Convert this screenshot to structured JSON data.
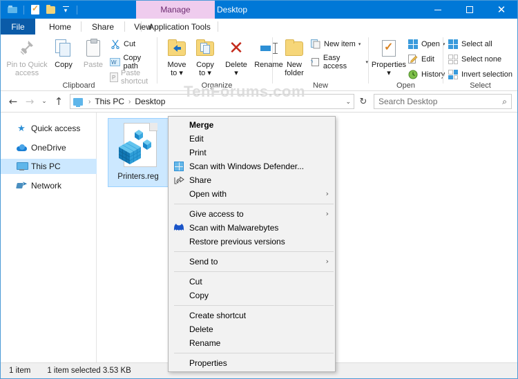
{
  "window": {
    "title": "Desktop",
    "contextual_tab": "Manage",
    "watermark": "TenForums.com",
    "controls": {
      "minimize": "–",
      "maximize": "□",
      "close": "✕"
    }
  },
  "quick_access_toolbar": {
    "items": [
      {
        "name": "explorer-icon",
        "label": "File Explorer"
      },
      {
        "name": "properties-icon",
        "label": "Properties"
      },
      {
        "name": "new-folder-icon",
        "label": "New folder"
      },
      {
        "name": "customize-icon",
        "label": "Customize Quick Access Toolbar"
      }
    ]
  },
  "tabs": [
    {
      "id": "file",
      "label": "File"
    },
    {
      "id": "home",
      "label": "Home"
    },
    {
      "id": "share",
      "label": "Share"
    },
    {
      "id": "view",
      "label": "View"
    },
    {
      "id": "application-tools",
      "label": "Application Tools"
    }
  ],
  "selected_tab": "Home",
  "ribbon": {
    "collapse_label": "^",
    "help_label": "?",
    "groups": [
      {
        "id": "clipboard",
        "label": "Clipboard",
        "big_buttons": [
          {
            "id": "pin-to-quick-access",
            "label": "Pin to Quick\naccess",
            "line1": "Pin to Quick",
            "line2": "access",
            "enabled": false
          },
          {
            "id": "copy",
            "label": "Copy",
            "enabled": true
          },
          {
            "id": "paste",
            "label": "Paste",
            "enabled": false
          }
        ],
        "small_buttons": [
          {
            "id": "cut",
            "label": "Cut",
            "enabled": true
          },
          {
            "id": "copy-path",
            "label": "Copy path",
            "enabled": true
          },
          {
            "id": "paste-shortcut",
            "label": "Paste shortcut",
            "enabled": false
          }
        ]
      },
      {
        "id": "organize",
        "label": "Organize",
        "big_buttons": [
          {
            "id": "move-to",
            "line1": "Move",
            "line2": "to ▾",
            "label": "Move to"
          },
          {
            "id": "copy-to",
            "line1": "Copy",
            "line2": "to ▾",
            "label": "Copy to"
          },
          {
            "id": "delete",
            "line1": "Delete",
            "line2": "▾",
            "label": "Delete"
          },
          {
            "id": "rename",
            "line1": "Rename",
            "line2": "",
            "label": "Rename"
          }
        ]
      },
      {
        "id": "new",
        "label": "New",
        "big_buttons": [
          {
            "id": "new-folder",
            "line1": "New",
            "line2": "folder",
            "label": "New folder"
          }
        ],
        "small_buttons": [
          {
            "id": "new-item",
            "label": "New item",
            "caret": "▾"
          },
          {
            "id": "easy-access",
            "label": "Easy access",
            "caret": "▾"
          }
        ]
      },
      {
        "id": "open",
        "label": "Open",
        "big_buttons": [
          {
            "id": "properties",
            "line1": "Properties",
            "line2": "▾",
            "label": "Properties"
          }
        ],
        "small_buttons": [
          {
            "id": "open",
            "label": "Open",
            "caret": "▾"
          },
          {
            "id": "edit",
            "label": "Edit"
          },
          {
            "id": "history",
            "label": "History"
          }
        ]
      },
      {
        "id": "select",
        "label": "Select",
        "small_buttons": [
          {
            "id": "select-all",
            "label": "Select all"
          },
          {
            "id": "select-none",
            "label": "Select none"
          },
          {
            "id": "invert-selection",
            "label": "Invert selection"
          }
        ]
      }
    ]
  },
  "address_bar": {
    "back": "←",
    "forward": "→",
    "recent": "⌄",
    "up": "↑",
    "breadcrumb": [
      {
        "label": "This PC"
      },
      {
        "label": "Desktop"
      }
    ],
    "separator": "›",
    "dropdown": "⌄",
    "refresh": "↻",
    "search_placeholder": "Search Desktop",
    "search_value": "",
    "search_icon": "⌕"
  },
  "nav_pane": {
    "items": [
      {
        "id": "quick-access",
        "label": "Quick access",
        "icon": "star-icon",
        "selected": false
      },
      {
        "id": "onedrive",
        "label": "OneDrive",
        "icon": "cloud-icon",
        "selected": false
      },
      {
        "id": "this-pc",
        "label": "This PC",
        "icon": "monitor-icon",
        "selected": true
      },
      {
        "id": "network",
        "label": "Network",
        "icon": "network-icon",
        "selected": false
      }
    ]
  },
  "file_view": {
    "items": [
      {
        "id": "printers-reg",
        "name": "Printers.reg",
        "icon": "registry-file-icon",
        "selected": true
      }
    ]
  },
  "context_menu": {
    "items": [
      {
        "id": "merge",
        "label": "Merge",
        "bold": true,
        "icon": null,
        "submenu": false
      },
      {
        "id": "edit",
        "label": "Edit",
        "bold": false,
        "icon": null,
        "submenu": false
      },
      {
        "id": "print",
        "label": "Print",
        "bold": false,
        "icon": null,
        "submenu": false
      },
      {
        "id": "scan-windows-defender",
        "label": "Scan with Windows Defender...",
        "bold": false,
        "icon": "defender-icon",
        "submenu": false
      },
      {
        "id": "share",
        "label": "Share",
        "bold": false,
        "icon": "share-icon",
        "submenu": false
      },
      {
        "id": "open-with",
        "label": "Open with",
        "bold": false,
        "icon": null,
        "submenu": true
      },
      {
        "id": "sep-1",
        "separator": true
      },
      {
        "id": "give-access-to",
        "label": "Give access to",
        "bold": false,
        "icon": null,
        "submenu": true
      },
      {
        "id": "scan-malwarebytes",
        "label": "Scan with Malwarebytes",
        "bold": false,
        "icon": "malwarebytes-icon",
        "submenu": false
      },
      {
        "id": "restore-previous-versions",
        "label": "Restore previous versions",
        "bold": false,
        "icon": null,
        "submenu": false
      },
      {
        "id": "sep-2",
        "separator": true
      },
      {
        "id": "send-to",
        "label": "Send to",
        "bold": false,
        "icon": null,
        "submenu": true
      },
      {
        "id": "sep-3",
        "separator": true
      },
      {
        "id": "cut",
        "label": "Cut",
        "bold": false,
        "icon": null,
        "submenu": false
      },
      {
        "id": "copy",
        "label": "Copy",
        "bold": false,
        "icon": null,
        "submenu": false
      },
      {
        "id": "sep-4",
        "separator": true
      },
      {
        "id": "create-shortcut",
        "label": "Create shortcut",
        "bold": false,
        "icon": null,
        "submenu": false
      },
      {
        "id": "delete",
        "label": "Delete",
        "bold": false,
        "icon": null,
        "submenu": false
      },
      {
        "id": "rename",
        "label": "Rename",
        "bold": false,
        "icon": null,
        "submenu": false
      },
      {
        "id": "sep-5",
        "separator": true
      },
      {
        "id": "properties",
        "label": "Properties",
        "bold": false,
        "icon": null,
        "submenu": false
      }
    ],
    "submenu_arrow": "›"
  },
  "status_bar": {
    "item_count": "1 item",
    "selection": "1 item selected  3.53 KB"
  },
  "colors": {
    "titlebar": "#0078d7",
    "file_tab": "#0a5ba8",
    "manage_tab_bg": "#efccee",
    "manage_tab_fg": "#6c2a70",
    "selection": "#cce8ff",
    "accent": "#2d8fd5"
  }
}
